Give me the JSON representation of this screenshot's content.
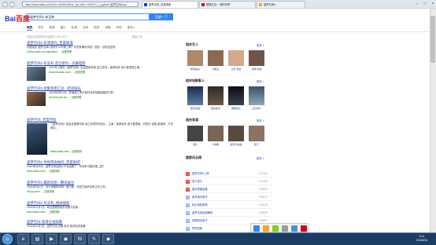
{
  "browser": {
    "address": "https://www.baidu.com/s?ie=utf-8&f=8&rsv_bp=1&tn=1001572_2_pg&wd=盗梦空间&oq=...",
    "tabs": [
      "盗梦空间_百度搜索",
      "楼梯栏目：'我的世界'",
      "盗梦空间2..."
    ],
    "back_icon": "back-arrow-icon",
    "forward_icon": "forward-arrow-icon"
  },
  "baidu": {
    "logo_a": "Bai",
    "logo_b": "百度",
    "query": "盗梦空间2 有没有",
    "search_button": "百度一下",
    "tabs": [
      "网页",
      "资讯",
      "视频",
      "图片",
      "知道",
      "文库",
      "贴吧",
      "地图",
      "采购",
      "更多»"
    ],
    "result_count": "百度为您找到相关结果约3,140,000个",
    "search_tools": "搜索工具"
  },
  "results": [
    {
      "title": "盗梦空间2 有消息吗_百度知道",
      "desc": "问题描述 盗梦空间2 到底什么时候上映？有没有确切消息？回答：目前还没有...",
      "url": "zhidao.baidu.com/question/... - 百度快照"
    },
    {
      "title": "盗梦空间2 有没有 诺兰新作 - 豆瓣电影",
      "desc": "2010年上映的《盗梦空间》由克里斯托弗·诺兰执导，莱昂纳多·迪卡普里奥主演...",
      "url": "movie.douban.com/... - 百度快照"
    },
    {
      "title": "盗梦空间2 续集消息汇总 - 新浪娱乐",
      "desc": "2016年8月10日 - 导演诺兰表示暂时没有拍摄续集的打算...",
      "url": "ent.sina.com.cn/... - 百度快照"
    },
    {
      "title": "盗梦空间_百度百科",
      "desc": "《盗梦空间》是由克里斯托弗·诺兰执导的科幻片，主演：莱昂纳多·迪卡普里奥、约瑟夫·高登-莱维特、艾伦·佩吉...",
      "url": "baike.baidu.com/ - 百度快照"
    },
    {
      "title": "盗梦空间2 你觉得会拍吗_百度贴吧",
      "desc": "2016年8月5日 - 盗梦空间这部片子太经典了，有没有可能拍第二部？",
      "url": "tieba.baidu.com/... - 百度快照"
    },
    {
      "title": "盗梦空间2 最新消息 - 腾讯娱乐",
      "desc": "2016年9月2日 - 关于续集的传闻一直不断，但官方始终没有正式公布...",
      "url": "ent.qq.com/... - 百度快照"
    },
    {
      "title": "盗梦空间2 有没有_相关搜索",
      "desc": "2016年12月1日 - 网友整理的相关问题与答案...",
      "url": "www.baidu.com/... - 百度快照"
    },
    {
      "title": "盗梦空间 高清在线观看",
      "desc": "2016年10月3日 - 盗梦空间 全集 高清 免费在线观看...",
      "url": "v.baidu.com/..."
    }
  ],
  "sidebar": {
    "related_people": "相关艺人",
    "related_movies": "相关电影影人",
    "related_directors": "相关导演",
    "ranking": "搜索风云榜",
    "more": "更多 »",
    "people": [
      "莱昂纳多",
      "约瑟夫",
      "艾伦·佩吉",
      "汤姆·哈迪"
    ],
    "movies": [
      "星际穿越",
      "致命魔术",
      "黑暗骑士",
      "记忆碎片"
    ],
    "directors": [
      "诺兰",
      "卡梅隆",
      "斯皮尔伯格",
      "昆汀"
    ],
    "rank_items": [
      {
        "n": "1",
        "t": "盗梦空间2上映",
        "v": "237406"
      },
      {
        "n": "2",
        "t": "诺兰新片",
        "v": "231459"
      },
      {
        "n": "3",
        "t": "星际穿越续集",
        "v": "209263"
      },
      {
        "n": "4",
        "t": "莱昂纳多新作",
        "v": "205217"
      },
      {
        "n": "5",
        "t": "科幻电影推荐",
        "v": "249015"
      },
      {
        "n": "6",
        "t": "盗梦空间结局解析",
        "v": "229409"
      },
      {
        "n": "7",
        "t": "陀螺是否倒下",
        "v": "216657"
      },
      {
        "n": "8",
        "t": "梦境层数",
        "v": "179023"
      },
      {
        "n": "9",
        "t": "经典悬疑片",
        "v": "176043"
      },
      {
        "n": "10",
        "t": "诺兰作品",
        "v": "173096"
      }
    ]
  },
  "taskbar": {
    "time": "9:14",
    "date": "2016/8/16",
    "apps": [
      "ie-icon",
      "folder-icon",
      "media-icon",
      "firefox-icon",
      "word-icon",
      "paint-icon",
      "other-icon"
    ]
  },
  "colors": {
    "accent": "#3385ff",
    "link": "#2440b3",
    "url": "#008000",
    "hot": "#f54545"
  }
}
